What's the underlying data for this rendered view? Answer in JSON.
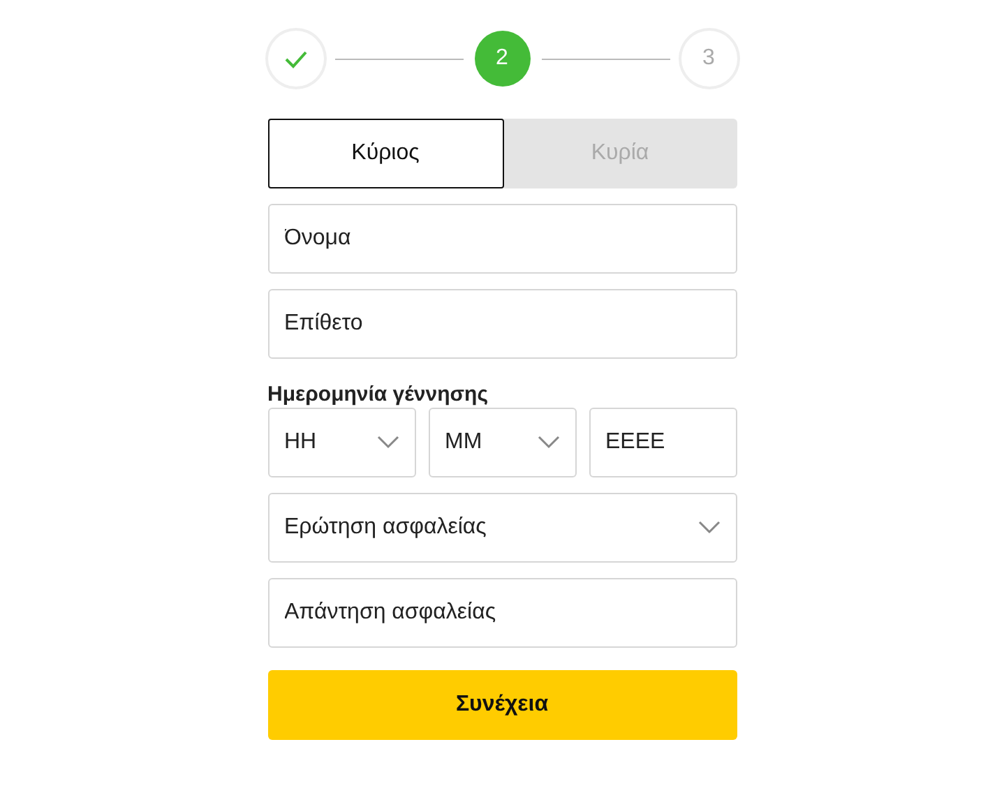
{
  "steps": [
    {
      "done": true,
      "current": false
    },
    {
      "label": "2",
      "done": false,
      "current": true
    },
    {
      "label": "3",
      "done": false,
      "current": false
    }
  ],
  "title_tabs": [
    {
      "label": "Κύριος",
      "selected": true
    },
    {
      "label": "Κυρία",
      "selected": false
    }
  ],
  "name_fields": [
    {
      "placeholder": "Όνομα"
    },
    {
      "placeholder": "Επίθετο"
    }
  ],
  "birth_date": {
    "label": "Ημερομηνία γέννησης",
    "parts": [
      {
        "kind": "select",
        "placeholder": "ΗΗ"
      },
      {
        "kind": "select",
        "placeholder": "ΜΜ"
      },
      {
        "kind": "input",
        "placeholder": "ΕΕΕΕ"
      }
    ]
  },
  "security": [
    {
      "kind": "select",
      "placeholder": "Ερώτηση ασφαλείας"
    },
    {
      "kind": "input",
      "placeholder": "Απάντηση ασφαλείας"
    }
  ],
  "continue_button": "Συνέχεια"
}
